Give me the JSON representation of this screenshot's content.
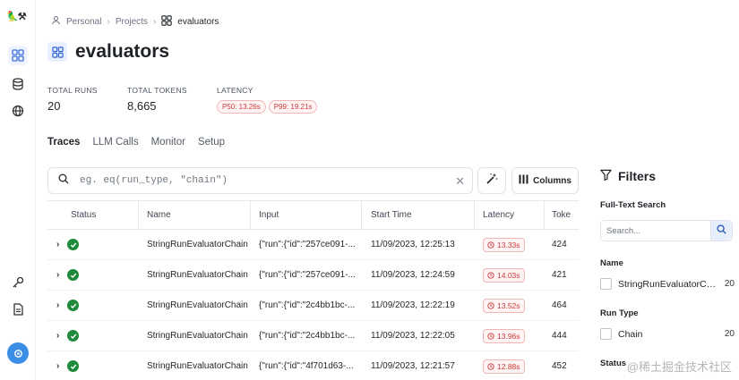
{
  "breadcrumb": {
    "personal": "Personal",
    "projects": "Projects",
    "current": "evaluators"
  },
  "page": {
    "title": "evaluators"
  },
  "stats": {
    "total_runs_label": "TOTAL RUNS",
    "total_runs": "20",
    "total_tokens_label": "TOTAL TOKENS",
    "total_tokens": "8,665",
    "latency_label": "LATENCY",
    "p50": "P50: 13.26s",
    "p99": "P99: 19.21s"
  },
  "tabs": [
    "Traces",
    "LLM Calls",
    "Monitor",
    "Setup"
  ],
  "search": {
    "placeholder": "eg. eq(run_type, \"chain\")"
  },
  "toolbar": {
    "columns_label": "Columns"
  },
  "table": {
    "columns": [
      "Status",
      "Name",
      "Input",
      "Start Time",
      "Latency",
      "Toke"
    ],
    "rows": [
      {
        "name": "StringRunEvaluatorChain",
        "input": "{\"run\":{\"id\":\"257ce091-...",
        "start": "11/09/2023, 12:25:13",
        "latency": "13.33s",
        "tokens": "424"
      },
      {
        "name": "StringRunEvaluatorChain",
        "input": "{\"run\":{\"id\":\"257ce091-...",
        "start": "11/09/2023, 12:24:59",
        "latency": "14.03s",
        "tokens": "421"
      },
      {
        "name": "StringRunEvaluatorChain",
        "input": "{\"run\":{\"id\":\"2c4bb1bc-...",
        "start": "11/09/2023, 12:22:19",
        "latency": "13.52s",
        "tokens": "464"
      },
      {
        "name": "StringRunEvaluatorChain",
        "input": "{\"run\":{\"id\":\"2c4bb1bc-...",
        "start": "11/09/2023, 12:22:05",
        "latency": "13.96s",
        "tokens": "444"
      },
      {
        "name": "StringRunEvaluatorChain",
        "input": "{\"run\":{\"id\":\"4f701d63-...",
        "start": "11/09/2023, 12:21:57",
        "latency": "12.88s",
        "tokens": "452"
      }
    ]
  },
  "filters": {
    "title": "Filters",
    "fulltext_label": "Full-Text Search",
    "search_placeholder": "Search...",
    "name_label": "Name",
    "name_option": "StringRunEvaluatorChain",
    "name_count": "20",
    "run_type_label": "Run Type",
    "run_type_option": "Chain",
    "run_type_count": "20",
    "status_label": "Status"
  },
  "watermark": "@稀土掘金技术社区",
  "colors": {
    "accent": "#3a6fd8",
    "success": "#1f8a3b",
    "danger": "#c93b3b"
  }
}
